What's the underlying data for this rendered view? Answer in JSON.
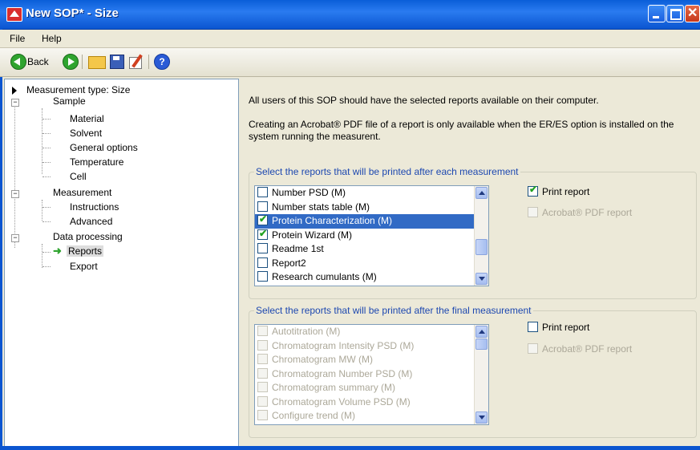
{
  "window": {
    "title": "New SOP* - Size"
  },
  "menu": {
    "file": "File",
    "help": "Help"
  },
  "toolbar": {
    "back_label": "Back",
    "help_glyph": "?"
  },
  "tree": {
    "root": "Measurement type: Size",
    "sample": "Sample",
    "material": "Material",
    "solvent": "Solvent",
    "general_options": "General options",
    "temperature": "Temperature",
    "cell": "Cell",
    "measurement": "Measurement",
    "instructions": "Instructions",
    "advanced": "Advanced",
    "data_processing": "Data processing",
    "reports": "Reports",
    "export": "Export"
  },
  "content": {
    "desc1": "All users of this SOP should have the selected reports available on their computer.",
    "desc2": "Creating an Acrobat® PDF file  of a report is only available when the ER/ES option is installed on the system running the measurent."
  },
  "group_each": {
    "title": "Select the reports that will be printed after each measurement",
    "items": [
      {
        "label": "Number PSD (M)",
        "checked": false
      },
      {
        "label": "Number stats table (M)",
        "checked": false
      },
      {
        "label": "Protein Characterization (M)",
        "checked": true,
        "selected": true
      },
      {
        "label": "Protein Wizard (M)",
        "checked": true
      },
      {
        "label": "Readme 1st",
        "checked": false
      },
      {
        "label": "Report2",
        "checked": false
      },
      {
        "label": "Research cumulants (M)",
        "checked": false
      }
    ],
    "print_report": "Print report",
    "print_report_checked": true,
    "pdf_report": "Acrobat® PDF report"
  },
  "group_final": {
    "title": "Select the reports that will be printed after the final measurement",
    "items": [
      {
        "label": "Autotitration (M)"
      },
      {
        "label": "Chromatogram Intensity PSD (M)"
      },
      {
        "label": "Chromatogram MW (M)"
      },
      {
        "label": "Chromatogram Number PSD (M)"
      },
      {
        "label": "Chromatogram summary (M)"
      },
      {
        "label": "Chromatogram Volume PSD (M)"
      },
      {
        "label": "Configure trend (M)"
      }
    ],
    "print_report": "Print report",
    "print_report_checked": false,
    "pdf_report": "Acrobat® PDF report"
  }
}
